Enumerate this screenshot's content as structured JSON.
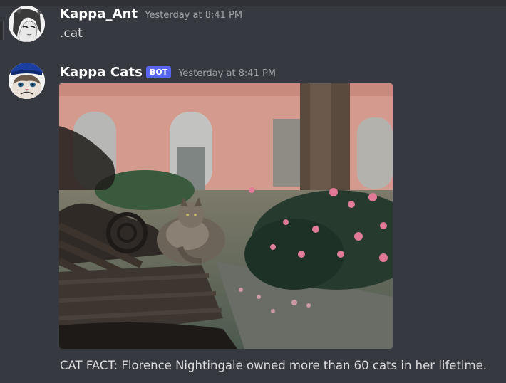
{
  "messages": [
    {
      "username": "Kappa_Ant",
      "timestamp": "Yesterday at 8:41 PM",
      "text": ".cat"
    },
    {
      "username": "Kappa Cats",
      "badge": "BOT",
      "timestamp": "Yesterday at 8:41 PM",
      "text": "CAT FACT: Florence Nightingale owned more than 60 cats in her lifetime."
    }
  ],
  "colors": {
    "background": "#36393f",
    "username": "#ffffff",
    "timestamp": "#a3a6aa",
    "badge": "#5865f2",
    "text": "#dcddde"
  }
}
